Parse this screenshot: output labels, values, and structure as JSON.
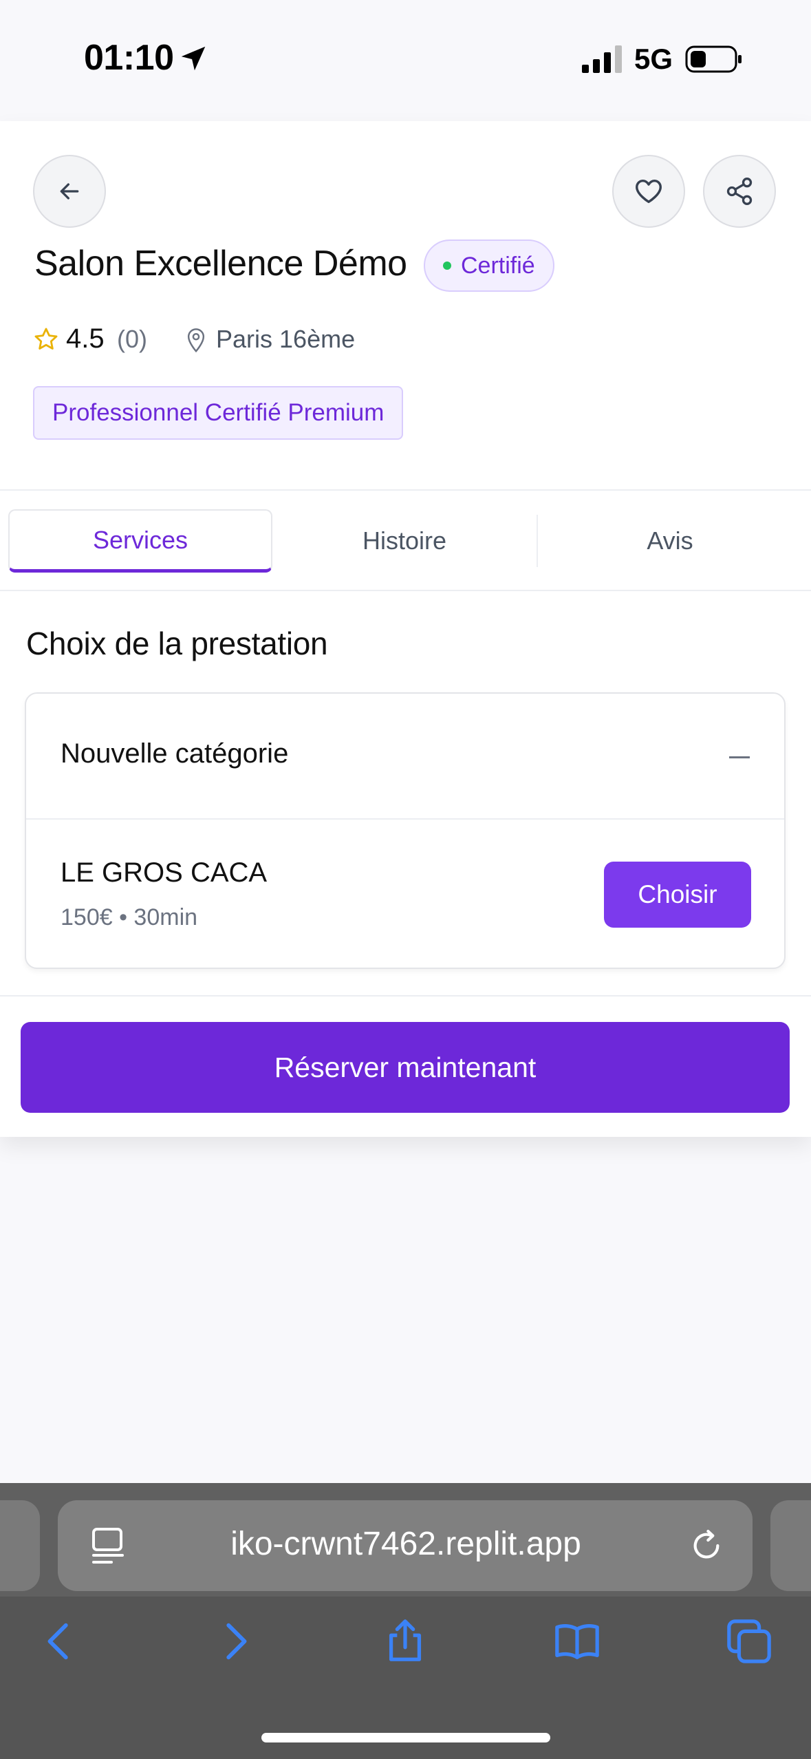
{
  "status_bar": {
    "time": "01:10",
    "network": "5G",
    "signal_bars": 3,
    "battery_level": 0.3
  },
  "profile": {
    "name": "Salon Excellence Démo",
    "certified_badge": "Certifié",
    "rating": "4.5",
    "review_count": "(0)",
    "location": "Paris 16ème",
    "premium_badge": "Professionnel Certifié Premium"
  },
  "tabs": [
    {
      "label": "Services",
      "active": true
    },
    {
      "label": "Histoire",
      "active": false
    },
    {
      "label": "Avis",
      "active": false
    }
  ],
  "services_section": {
    "title": "Choix de la prestation",
    "category": "Nouvelle catégorie",
    "items": [
      {
        "name": "LE GROS CACA",
        "meta": "150€ • 30min",
        "button": "Choisir"
      }
    ]
  },
  "cta": {
    "label": "Réserver maintenant"
  },
  "browser": {
    "url": "iko-crwnt7462.replit.app"
  },
  "colors": {
    "primary": "#6d28d9",
    "accent": "#7c3aed",
    "safari_blue": "#3b82f6"
  }
}
